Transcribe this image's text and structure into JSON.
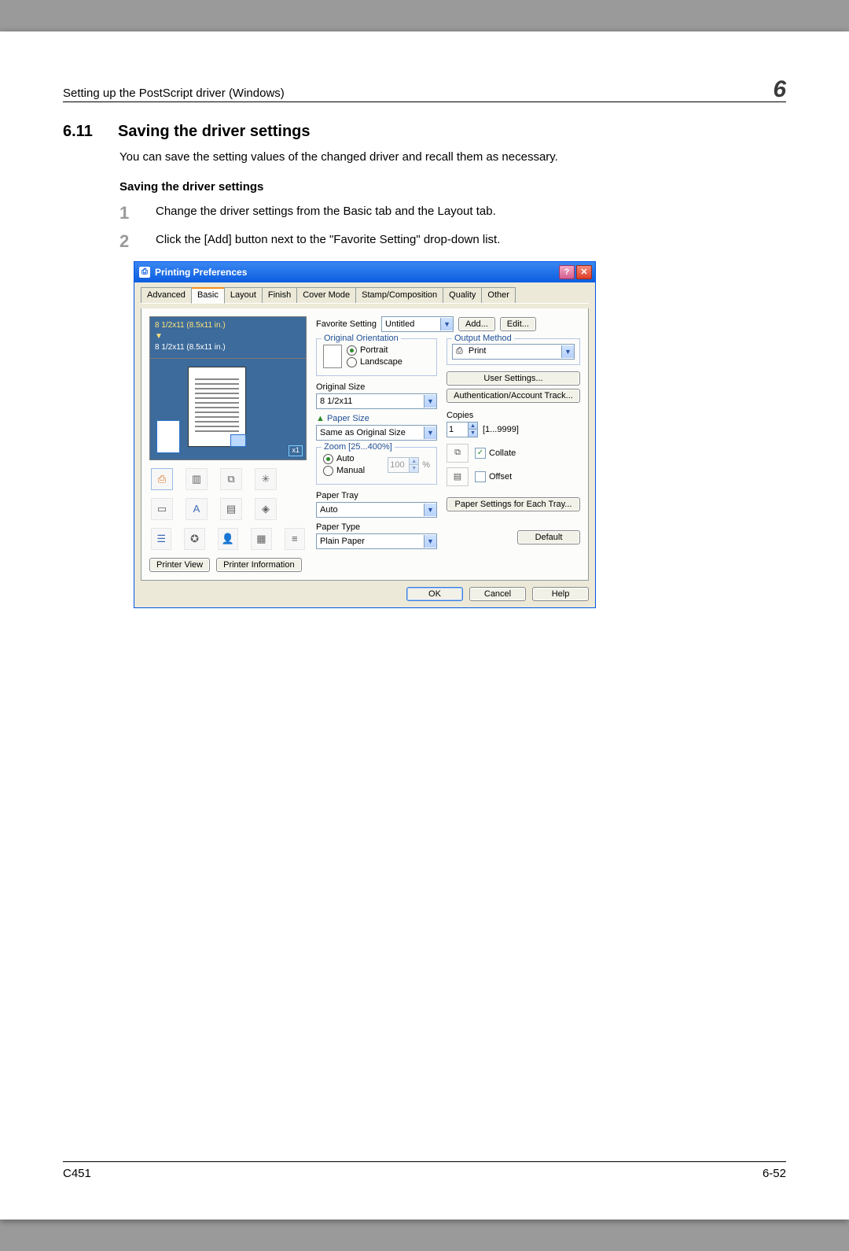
{
  "header": {
    "text": "Setting up the PostScript driver (Windows)",
    "chapter": "6"
  },
  "section": {
    "number": "6.11",
    "title": "Saving the driver settings",
    "intro": "You can save the setting values of the changed driver and recall them as necessary.",
    "sub_title": "Saving the driver settings",
    "steps": [
      "Change the driver settings from the Basic tab and the Layout tab.",
      "Click the [Add] button next to the \"Favorite Setting\" drop-down list."
    ]
  },
  "dialog": {
    "title": "Printing Preferences",
    "tabs": [
      "Advanced",
      "Basic",
      "Layout",
      "Finish",
      "Cover Mode",
      "Stamp/Composition",
      "Quality",
      "Other"
    ],
    "active_tab": "Basic",
    "favorite": {
      "label": "Favorite Setting",
      "value": "Untitled",
      "add": "Add...",
      "edit": "Edit..."
    },
    "preview": {
      "line_top": "8 1/2x11 (8.5x11 in.)",
      "line_bottom": "8 1/2x11 (8.5x11 in.)",
      "x1": "x1",
      "printer_view": "Printer View",
      "printer_info": "Printer Information"
    },
    "orientation": {
      "group": "Original Orientation",
      "portrait": "Portrait",
      "landscape": "Landscape"
    },
    "original_size": {
      "label": "Original Size",
      "value": "8 1/2x11"
    },
    "paper_size": {
      "label": "Paper Size",
      "value": "Same as Original Size"
    },
    "zoom": {
      "group": "Zoom [25...400%]",
      "auto": "Auto",
      "manual": "Manual",
      "val": "100",
      "pct": "%"
    },
    "paper_tray": {
      "label": "Paper Tray",
      "value": "Auto"
    },
    "paper_type": {
      "label": "Paper Type",
      "value": "Plain Paper"
    },
    "output_method": {
      "group": "Output Method",
      "value": "Print",
      "user_settings": "User Settings...",
      "auth": "Authentication/Account Track..."
    },
    "copies": {
      "label": "Copies",
      "value": "1",
      "range": "[1...9999]",
      "collate": "Collate",
      "offset": "Offset"
    },
    "each_tray": "Paper Settings for Each Tray...",
    "default": "Default",
    "buttons": {
      "ok": "OK",
      "cancel": "Cancel",
      "help": "Help"
    }
  },
  "footer": {
    "left": "C451",
    "right": "6-52"
  }
}
